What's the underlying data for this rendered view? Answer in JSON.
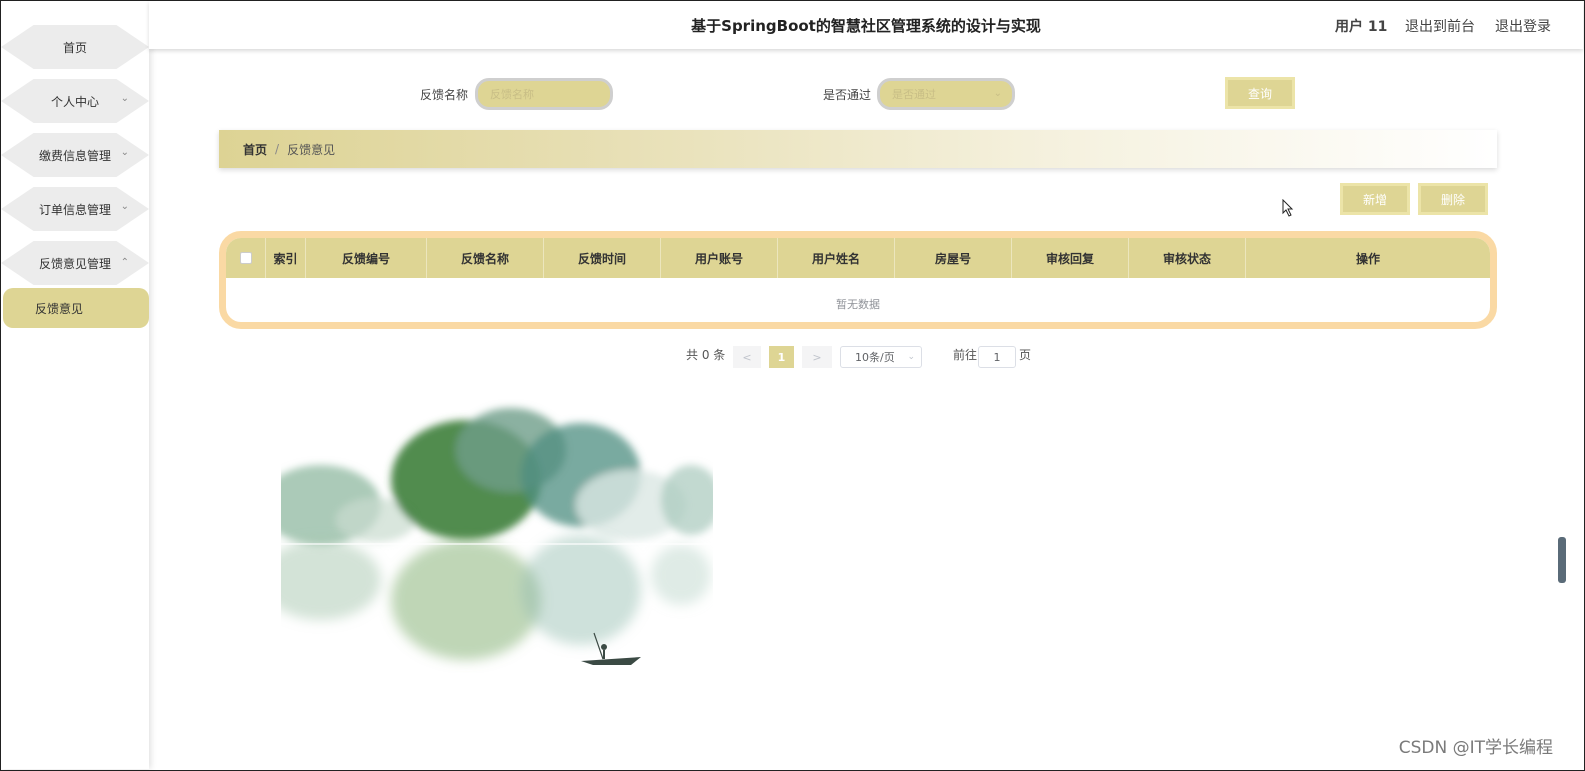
{
  "header": {
    "title": "基于SpringBoot的智慧社区管理系统的设计与实现",
    "user": "用户 11",
    "front_link": "退出到前台",
    "logout_link": "退出登录"
  },
  "sidebar": {
    "items": [
      {
        "label": "首页"
      },
      {
        "label": "个人中心"
      },
      {
        "label": "缴费信息管理"
      },
      {
        "label": "订单信息管理"
      },
      {
        "label": "反馈意见管理"
      }
    ],
    "active_sub": "反馈意见"
  },
  "search": {
    "name_label": "反馈名称",
    "name_placeholder": "反馈名称",
    "pass_label": "是否通过",
    "pass_placeholder": "是否通过",
    "query_button": "查询"
  },
  "breadcrumb": {
    "home": "首页",
    "separator": "/",
    "current": "反馈意见"
  },
  "actions": {
    "add": "新增",
    "delete": "删除"
  },
  "table": {
    "columns": [
      "索引",
      "反馈编号",
      "反馈名称",
      "反馈时间",
      "用户账号",
      "用户姓名",
      "房屋号",
      "审核回复",
      "审核状态",
      "操作"
    ],
    "empty_text": "暂无数据"
  },
  "pagination": {
    "total": "共 0 条",
    "prev": "<",
    "current_page": "1",
    "next": ">",
    "page_size": "10条/页",
    "goto_label": "前往",
    "goto_value": "1",
    "page_unit": "页"
  },
  "watermark": "CSDN @IT学长编程",
  "colors": {
    "accent": "#ded594",
    "table_border": "#fad9a4"
  }
}
